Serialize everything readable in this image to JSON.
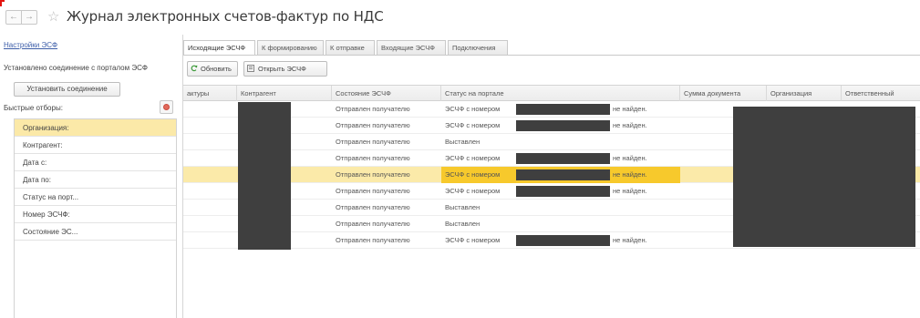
{
  "window": {
    "title": "Журнал электронных счетов-фактур по НДС",
    "back_icon": "arrow-left-icon",
    "forward_icon": "arrow-right-icon",
    "favorite_icon": "star-icon"
  },
  "sidebar": {
    "settings_link": "Настройки ЭСФ",
    "connection_status": "Установлено соединение с порталом ЭСФ",
    "connect_button": "Установить соединение",
    "quick_filters_label": "Быстрые отборы:",
    "filters": [
      {
        "label": "Организация:"
      },
      {
        "label": "Контрагент:"
      },
      {
        "label": "Дата с:"
      },
      {
        "label": "Дата по:"
      },
      {
        "label": "Статус на порт..."
      },
      {
        "label": "Номер ЭСЧФ:"
      },
      {
        "label": "Состояние ЭС..."
      }
    ]
  },
  "tabs": [
    {
      "label": "Исходящие ЭСЧФ"
    },
    {
      "label": "К формированию"
    },
    {
      "label": "К отправке"
    },
    {
      "label": "Входящие ЭСЧФ"
    },
    {
      "label": "Подключения"
    }
  ],
  "toolbar": {
    "refresh_label": "Обновить",
    "open_label": "Открыть ЭСЧФ"
  },
  "table": {
    "columns": [
      "актуры",
      "Контрагент",
      "Состояние ЭСЧФ",
      "Статус на портале",
      "Сумма документа",
      "Организация",
      "Ответственный"
    ],
    "rows": [
      {
        "state": "Отправлен получателю",
        "portal_prefix": "ЭСЧФ с номером",
        "portal_suffix": "не найден."
      },
      {
        "state": "Отправлен получателю",
        "portal_prefix": "ЭСЧФ с номером",
        "portal_suffix": "не найден."
      },
      {
        "state": "Отправлен получателю",
        "portal_prefix": "Выставлен",
        "portal_suffix": ""
      },
      {
        "state": "Отправлен получателю",
        "portal_prefix": "ЭСЧФ с номером",
        "portal_suffix": "не найден."
      },
      {
        "state": "Отправлен получателю",
        "portal_prefix": "ЭСЧФ с номером",
        "portal_suffix": "не найден."
      },
      {
        "state": "Отправлен получателю",
        "portal_prefix": "ЭСЧФ с номером",
        "portal_suffix": "не найден."
      },
      {
        "state": "Отправлен получателю",
        "portal_prefix": "Выставлен",
        "portal_suffix": ""
      },
      {
        "state": "Отправлен получателю",
        "portal_prefix": "Выставлен",
        "portal_suffix": ""
      },
      {
        "state": "Отправлен получателю",
        "portal_prefix": "ЭСЧФ с номером",
        "portal_suffix": "не найден."
      }
    ],
    "selected_row": 4
  },
  "colors": {
    "selection": "#fbeaa9",
    "selection_strong": "#f7c92c",
    "link": "#3d5ea9",
    "accent": "#e3140f"
  }
}
